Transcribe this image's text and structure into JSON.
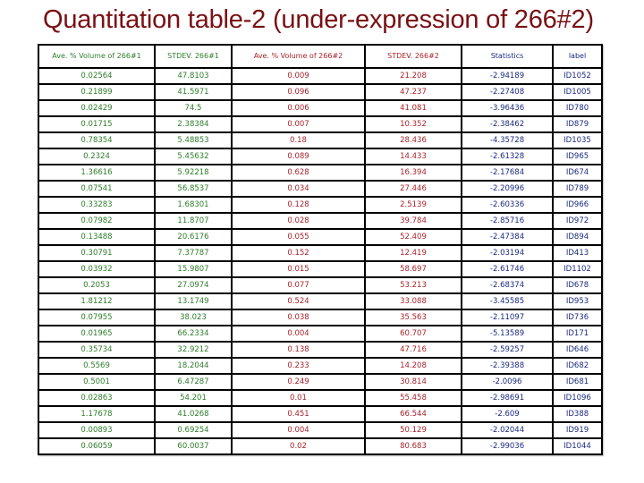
{
  "title": "Quantitation table-2 (under-expression of 266#2)",
  "colors": {
    "title": "#7a1014",
    "group1": "#2e7d2a",
    "group2": "#a8232a",
    "stats": "#1a2a80"
  },
  "table": {
    "headers": [
      "Ave. % Volume of 266#1",
      "STDEV. 266#1",
      "Ave. % Volume of 266#2",
      "STDEV. 266#2",
      "Statistics",
      "label"
    ],
    "rows": [
      [
        "0.02564",
        "47.8103",
        "0.009",
        "21.208",
        "-2.94189",
        "ID1052"
      ],
      [
        "0.21899",
        "41.5971",
        "0.096",
        "47.237",
        "-2.27408",
        "ID1005"
      ],
      [
        "0.02429",
        "74.5",
        "0.006",
        "41.081",
        "-3.96436",
        "ID780"
      ],
      [
        "0.01715",
        "2.38384",
        "0.007",
        "10.352",
        "-2.38462",
        "ID879"
      ],
      [
        "0.78354",
        "5.48853",
        "0.18",
        "28.436",
        "-4.35728",
        "ID1035"
      ],
      [
        "0.2324",
        "5.45632",
        "0.089",
        "14.433",
        "-2.61328",
        "ID965"
      ],
      [
        "1.36616",
        "5.92218",
        "0.628",
        "16.394",
        "-2.17684",
        "ID674"
      ],
      [
        "0.07541",
        "56.8537",
        "0.034",
        "27.446",
        "-2.20996",
        "ID789"
      ],
      [
        "0.33283",
        "1.68301",
        "0.128",
        "2.5139",
        "-2.60336",
        "ID966"
      ],
      [
        "0.07982",
        "11.8707",
        "0.028",
        "39.784",
        "-2.85716",
        "ID972"
      ],
      [
        "0.13488",
        "20.6176",
        "0.055",
        "52.409",
        "-2.47384",
        "ID894"
      ],
      [
        "0.30791",
        "7.37787",
        "0.152",
        "12.419",
        "-2.03194",
        "ID413"
      ],
      [
        "0.03932",
        "15.9807",
        "0.015",
        "58.697",
        "-2.61746",
        "ID1102"
      ],
      [
        "0.2053",
        "27.0974",
        "0.077",
        "53.213",
        "-2.68374",
        "ID678"
      ],
      [
        "1.81212",
        "13.1749",
        "0.524",
        "33.088",
        "-3.45585",
        "ID953"
      ],
      [
        "0.07955",
        "38.023",
        "0.038",
        "35.563",
        "-2.11097",
        "ID736"
      ],
      [
        "0.01965",
        "66.2334",
        "0.004",
        "60.707",
        "-5.13589",
        "ID171"
      ],
      [
        "0.35734",
        "32.9212",
        "0.138",
        "47.716",
        "-2.59257",
        "ID646"
      ],
      [
        "0.5569",
        "18.2044",
        "0.233",
        "14.208",
        "-2.39388",
        "ID682"
      ],
      [
        "0.5001",
        "6.47287",
        "0.249",
        "30.814",
        "-2.0096",
        "ID681"
      ],
      [
        "0.02863",
        "54.201",
        "0.01",
        "55.458",
        "-2.98691",
        "ID1096"
      ],
      [
        "1.17678",
        "41.0268",
        "0.451",
        "66.544",
        "-2.609",
        "ID388"
      ],
      [
        "0.00893",
        "0.69254",
        "0.004",
        "50.129",
        "-2.02044",
        "ID919"
      ],
      [
        "0.06059",
        "60.0037",
        "0.02",
        "80.683",
        "-2.99036",
        "ID1044"
      ]
    ]
  }
}
